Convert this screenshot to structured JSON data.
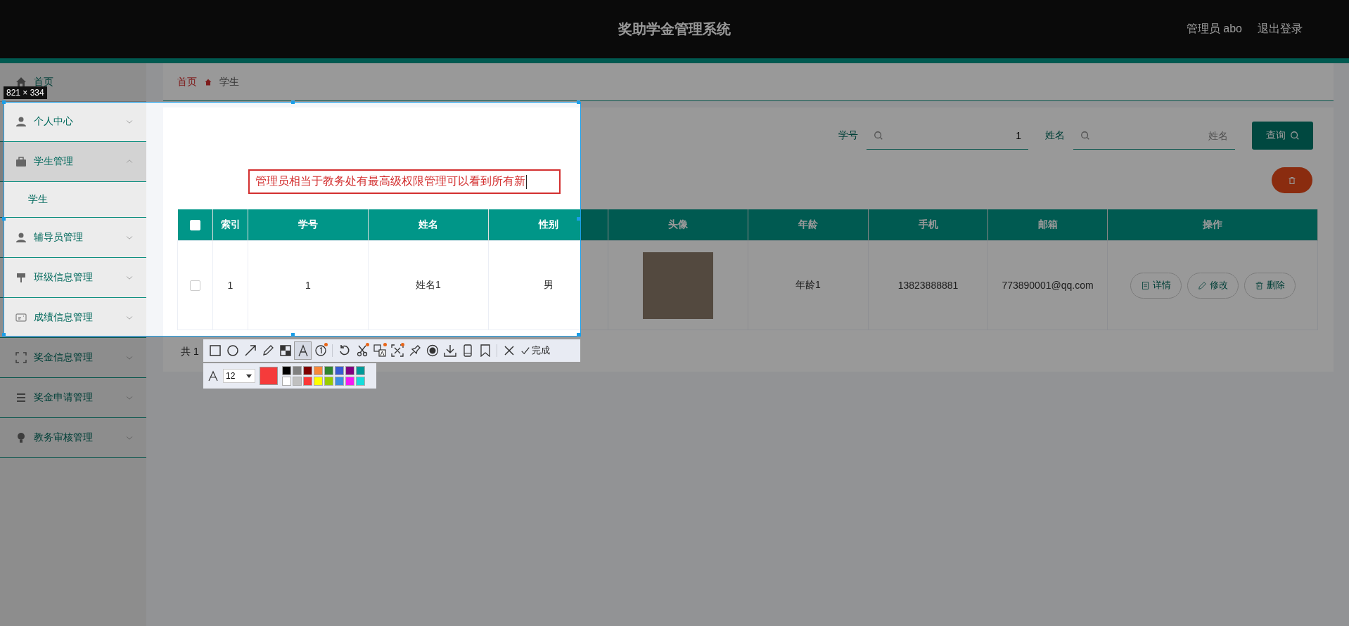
{
  "header": {
    "title": "奖助学金管理系统",
    "user": "管理员 abo",
    "logout": "退出登录"
  },
  "sidebar": {
    "items": [
      {
        "kind": "link",
        "label": "首页"
      },
      {
        "kind": "group",
        "label": "个人中心",
        "expanded": false
      },
      {
        "kind": "group",
        "label": "学生管理",
        "expanded": true,
        "children": [
          {
            "label": "学生",
            "selected": true
          }
        ]
      },
      {
        "kind": "group",
        "label": "辅导员管理",
        "expanded": false
      },
      {
        "kind": "group",
        "label": "班级信息管理",
        "expanded": false
      },
      {
        "kind": "group",
        "label": "成绩信息管理",
        "expanded": false
      },
      {
        "kind": "group",
        "label": "奖金信息管理",
        "expanded": false
      },
      {
        "kind": "group",
        "label": "奖金申请管理",
        "expanded": false
      },
      {
        "kind": "group",
        "label": "教务审核管理",
        "expanded": false
      }
    ]
  },
  "breadcrumb": [
    {
      "label": "首页"
    },
    {
      "label": "学生"
    }
  ],
  "search": {
    "fields": [
      {
        "label": "学号",
        "value": "1"
      },
      {
        "label": "姓名",
        "placeholder": "姓名"
      }
    ],
    "button": "查询"
  },
  "table": {
    "header_checked": false,
    "columns": [
      "索引",
      "学号",
      "姓名",
      "性别",
      "头像",
      "年龄",
      "手机",
      "邮箱",
      "操作"
    ],
    "rows": [
      {
        "checked": false,
        "cells": [
          {
            "kind": "text",
            "text": "1"
          },
          {
            "kind": "text",
            "text": "1"
          },
          {
            "kind": "text",
            "text": "姓名1"
          },
          {
            "kind": "text",
            "text": "男"
          },
          {
            "kind": "photo"
          },
          {
            "kind": "text",
            "text": "年龄1"
          },
          {
            "kind": "text",
            "text": "13823888881"
          },
          {
            "kind": "text",
            "text": "773890001@qq.com"
          },
          {
            "kind": "actions",
            "actions": [
              {
                "kind": "detail",
                "label": "详情"
              },
              {
                "kind": "edit",
                "label": "修改"
              },
              {
                "kind": "delete",
                "label": "删除"
              }
            ]
          }
        ]
      }
    ]
  },
  "pagination": "共 1",
  "screenshot_tool": {
    "size_label": "821 × 334",
    "annotation": "管理员相当于教务处有最高级权限管理可以看到所有新",
    "tool_groups": [
      [
        {
          "kind": "rect",
          "selected": false,
          "dot": false
        },
        {
          "kind": "ellipse",
          "selected": false,
          "dot": false
        },
        {
          "kind": "arrow",
          "selected": false,
          "dot": false
        },
        {
          "kind": "pencil",
          "selected": false,
          "dot": false
        },
        {
          "kind": "mosaic",
          "selected": false,
          "dot": false
        },
        {
          "kind": "text",
          "selected": true,
          "dot": false
        },
        {
          "kind": "number",
          "selected": false,
          "dot": true
        }
      ],
      [
        {
          "kind": "undo",
          "selected": false,
          "dot": false
        },
        {
          "kind": "cut",
          "selected": false,
          "dot": true
        },
        {
          "kind": "translate",
          "selected": false,
          "dot": true
        },
        {
          "kind": "ocr",
          "selected": false,
          "dot": true
        },
        {
          "kind": "pin",
          "selected": false,
          "dot": false
        },
        {
          "kind": "record",
          "selected": false,
          "dot": false
        },
        {
          "kind": "download",
          "selected": false,
          "dot": false
        },
        {
          "kind": "phone",
          "selected": false,
          "dot": false
        },
        {
          "kind": "bookmark",
          "selected": false,
          "dot": false
        }
      ],
      [
        {
          "kind": "close",
          "selected": false,
          "dot": false
        }
      ]
    ],
    "done": "完成",
    "font_size": "12",
    "palette": [
      {
        "color": "#000000"
      },
      {
        "color": "#808080"
      },
      {
        "color": "#800000"
      },
      {
        "color": "#f7883a"
      },
      {
        "color": "#308430"
      },
      {
        "color": "#385ad3"
      },
      {
        "color": "#800080"
      },
      {
        "color": "#009999"
      },
      {
        "color": "#ffffff"
      },
      {
        "color": "#c0c0c0"
      },
      {
        "color": "#fb3838"
      },
      {
        "color": "#ffff00"
      },
      {
        "color": "#99cc00"
      },
      {
        "color": "#3d8ee2"
      },
      {
        "color": "#f31bf3"
      },
      {
        "color": "#16dcdc"
      }
    ]
  }
}
